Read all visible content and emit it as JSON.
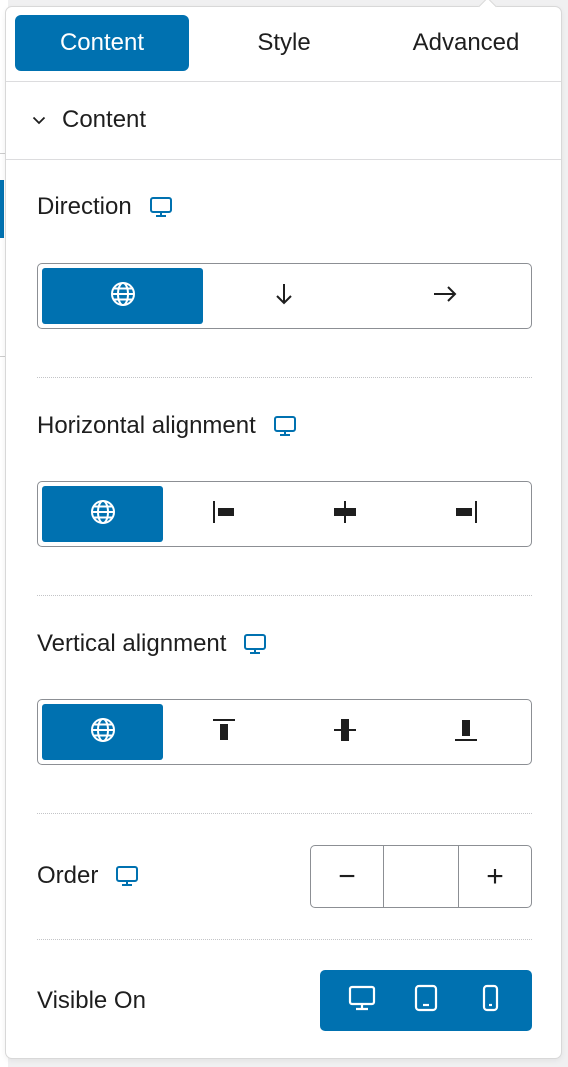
{
  "tabs": [
    {
      "label": "Content",
      "active": true
    },
    {
      "label": "Style",
      "active": false
    },
    {
      "label": "Advanced",
      "active": false
    }
  ],
  "section": {
    "title": "Content",
    "expanded": true
  },
  "fields": {
    "direction": {
      "label": "Direction",
      "options": [
        "globe-icon",
        "arrow-down-icon",
        "arrow-right-icon"
      ],
      "selected": 0
    },
    "horizontal_alignment": {
      "label": "Horizontal alignment",
      "options": [
        "globe-icon",
        "align-left-icon",
        "align-center-icon",
        "align-right-icon"
      ],
      "selected": 0
    },
    "vertical_alignment": {
      "label": "Vertical alignment",
      "options": [
        "globe-icon",
        "align-top-icon",
        "align-middle-icon",
        "align-bottom-icon"
      ],
      "selected": 0
    },
    "order": {
      "label": "Order",
      "value": "",
      "decrement": "−",
      "increment": "+"
    },
    "visible_on": {
      "label": "Visible On",
      "devices": [
        "desktop-icon",
        "tablet-icon",
        "mobile-icon"
      ]
    }
  },
  "colors": {
    "accent": "#0071b0",
    "border": "#8c8f94",
    "text": "#1e1e1e"
  }
}
